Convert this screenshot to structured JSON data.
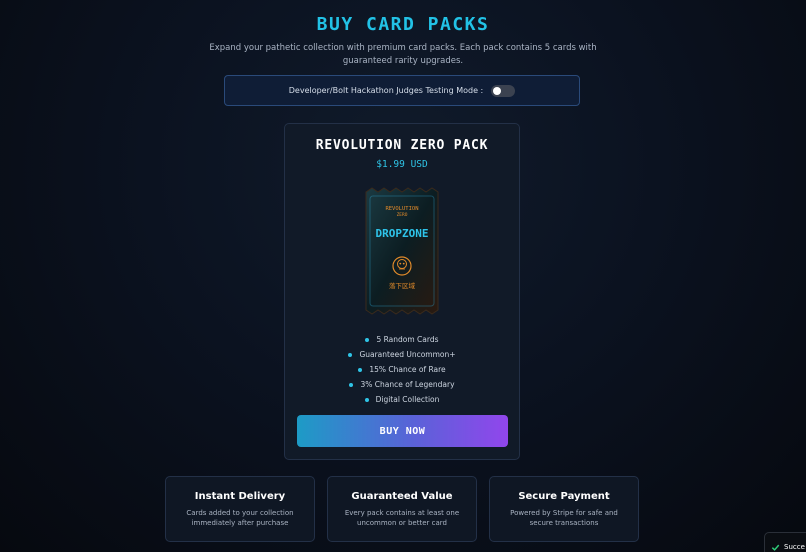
{
  "page": {
    "title": "BUY CARD PACKS",
    "subtitle": "Expand your pathetic collection with premium card packs. Each pack contains 5 cards with guaranteed rarity upgrades."
  },
  "dev_mode": {
    "label": "Developer/Bolt Hackathon Judges Testing Mode :",
    "enabled": false
  },
  "pack": {
    "name": "REVOLUTION ZERO PACK",
    "price": "$1.99 USD",
    "art": {
      "brand_top": "REVOLUTION",
      "brand_sub": "ZERO",
      "logo_text": "DROPZONE",
      "icon": "skull-emblem-icon",
      "bottom_text": "落下区域"
    },
    "features": [
      "5 Random Cards",
      "Guaranteed Uncommon+",
      "15% Chance of Rare",
      "3% Chance of Legendary",
      "Digital Collection"
    ],
    "buy_label": "BUY NOW"
  },
  "info_cards": [
    {
      "title": "Instant Delivery",
      "desc": "Cards added to your collection immediately after purchase"
    },
    {
      "title": "Guaranteed Value",
      "desc": "Every pack contains at least one uncommon or better card"
    },
    {
      "title": "Secure Payment",
      "desc": "Powered by Stripe for safe and secure transactions"
    }
  ],
  "toast": {
    "icon": "check-icon",
    "text": "Succe"
  },
  "colors": {
    "accent": "#22c2e6",
    "button_start": "#1d9bc6",
    "button_end": "#9146ec",
    "pack_art_glow": "#2ea8d6",
    "pack_art_accent": "#e08a2a"
  }
}
